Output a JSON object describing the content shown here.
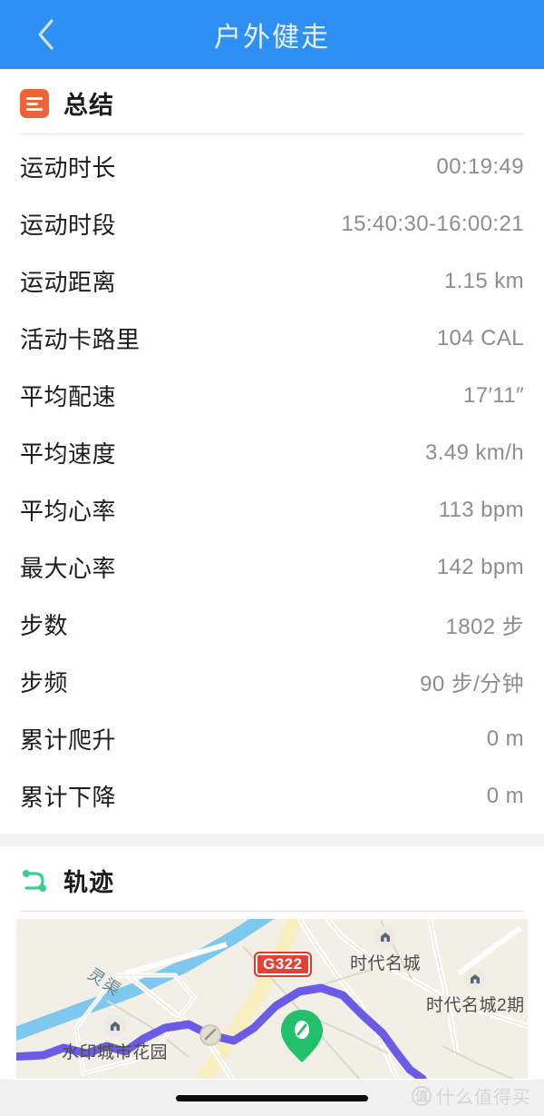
{
  "header": {
    "title": "户外健走",
    "back_icon": "chevron-left-icon",
    "bg_color": "#2e90f5",
    "title_color": "#e8f2ff"
  },
  "summary_section": {
    "title": "总结",
    "icon": "summary-list-icon",
    "icon_color": "#ec6437",
    "rows": [
      {
        "label": "运动时长",
        "value": "00:19:49"
      },
      {
        "label": "运动时段",
        "value": "15:40:30-16:00:21"
      },
      {
        "label": "运动距离",
        "value": "1.15 km"
      },
      {
        "label": "活动卡路里",
        "value": "104 CAL"
      },
      {
        "label": "平均配速",
        "value": "17′11″"
      },
      {
        "label": "平均速度",
        "value": "3.49 km/h"
      },
      {
        "label": "平均心率",
        "value": "113 bpm"
      },
      {
        "label": "最大心率",
        "value": "142 bpm"
      },
      {
        "label": "步数",
        "value": "1802 步"
      },
      {
        "label": "步频",
        "value": "90 步/分钟"
      },
      {
        "label": "累计爬升",
        "value": "0 m"
      },
      {
        "label": "累计下降",
        "value": "0 m"
      }
    ]
  },
  "track_section": {
    "title": "轨迹",
    "icon": "route-path-icon",
    "icon_color": "#3bcf8e",
    "map": {
      "background_color": "#f2efe6",
      "river_label": "灵渠",
      "river_color": "#7ec8ef",
      "highway_shield": "G322",
      "shield_color": "#de4336",
      "track_color": "#6b5ce7",
      "marker_color": "#22c06a",
      "pois": [
        {
          "name": "时代名城",
          "icon": "building-poi-icon"
        },
        {
          "name": "时代名城2期",
          "icon": "building-poi-icon"
        },
        {
          "name": "水印城市花园",
          "icon": "building-poi-icon"
        }
      ]
    }
  },
  "bottom": {
    "home_indicator": "home-indicator",
    "watermark_logo": "值",
    "watermark_text": "什么值得买"
  }
}
